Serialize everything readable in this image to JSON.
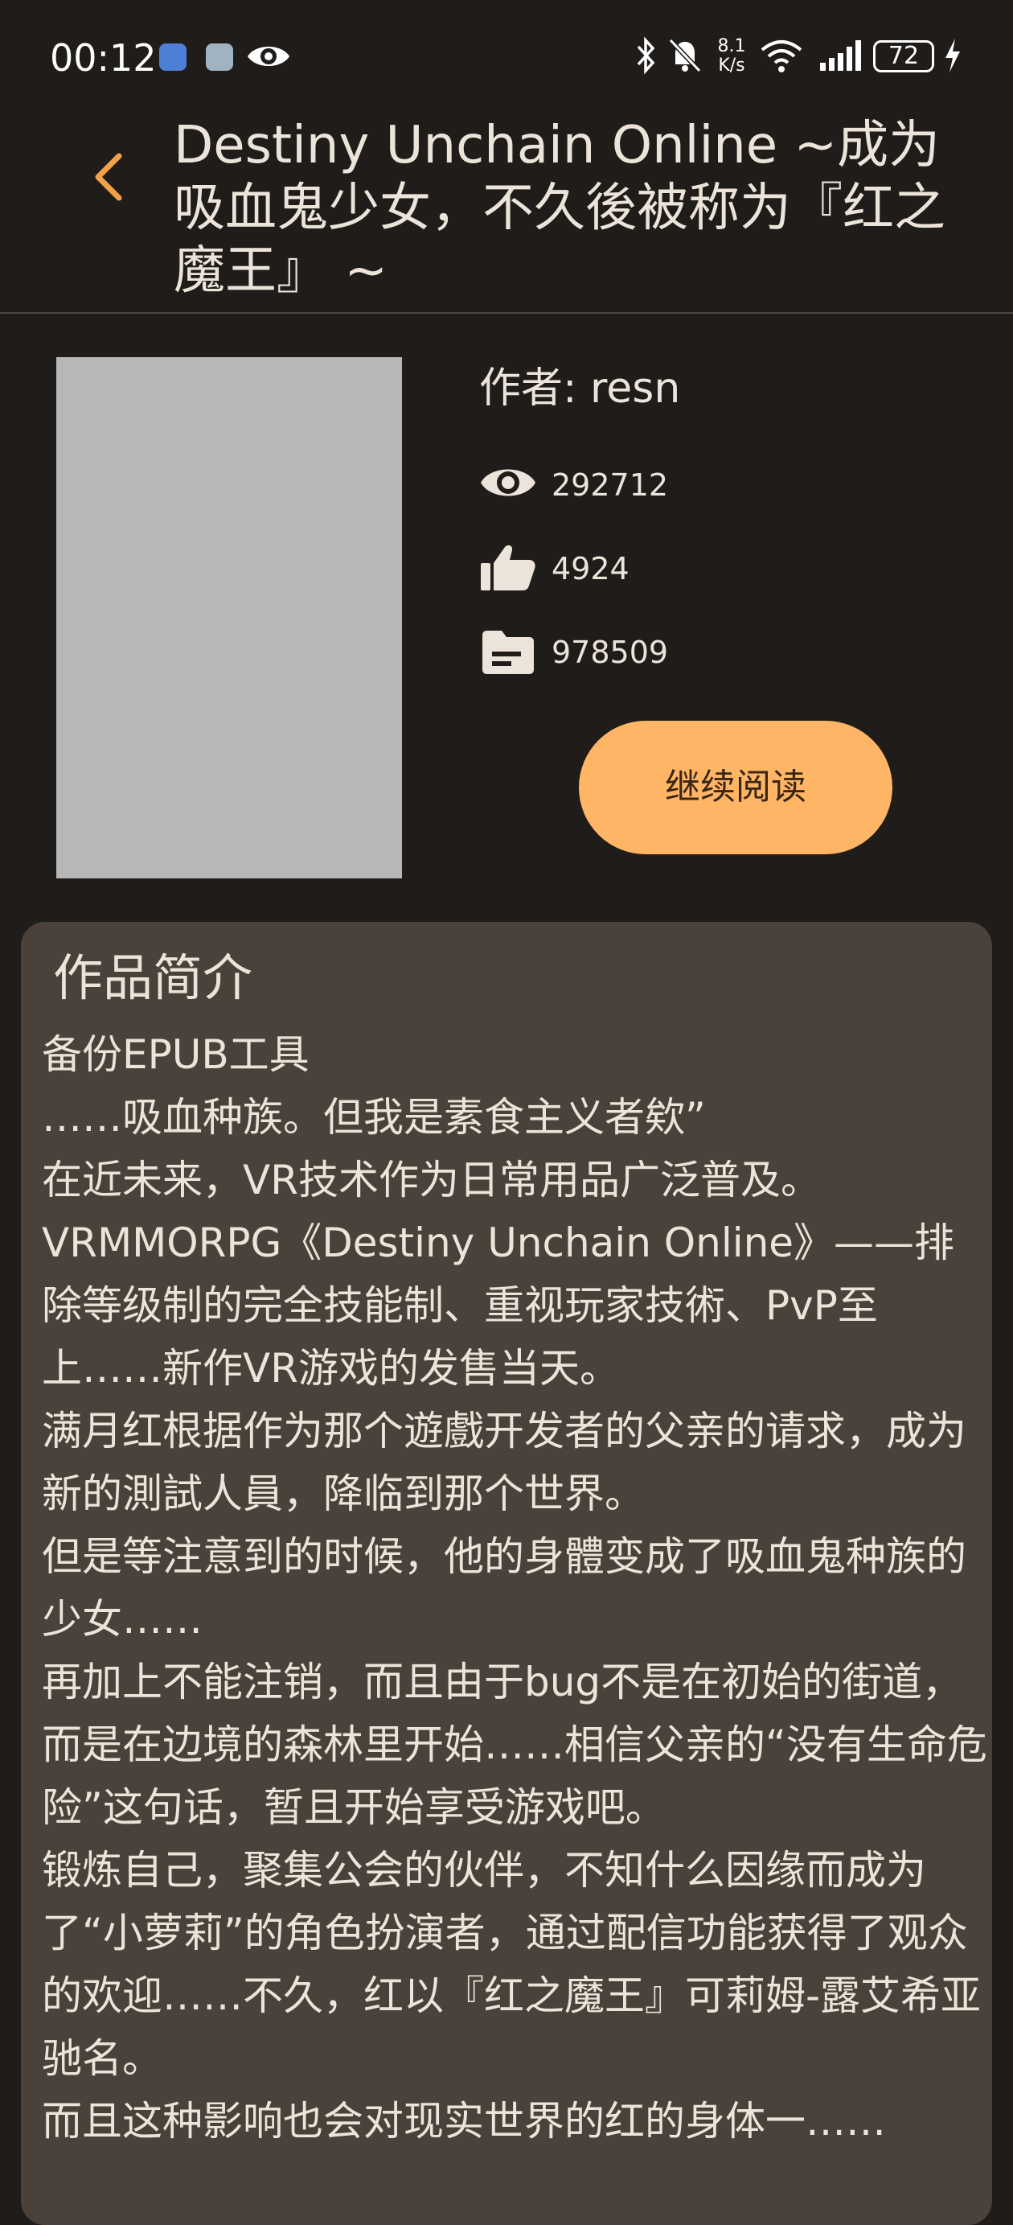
{
  "status_bar": {
    "time": "00:12",
    "network_speed_value": "8.1",
    "network_speed_unit": "K/s",
    "battery": "72",
    "icons": [
      "app-icon-1",
      "app-icon-2",
      "eye-icon",
      "bluetooth-icon",
      "mute-icon",
      "wifi-icon",
      "signal-icon",
      "battery-icon",
      "charging-icon"
    ]
  },
  "header": {
    "title": "Destiny Unchain Online ~成为吸血鬼少女，不久後被称为『红之魔王』 ~",
    "back_icon": "chevron-left-icon"
  },
  "book": {
    "author_label": "作者: resn",
    "views": "292712",
    "likes": "4924",
    "words": "978509",
    "continue_label": "继续阅读"
  },
  "synopsis": {
    "title": "作品简介",
    "paragraphs": [
      "备份EPUB工具",
      "……吸血种族。但我是素食主义者欸”",
      "在近未来，VR技术作为日常用品广泛普及。",
      "VRMMORPG《Destiny Unchain Online》——排除等级制的完全技能制、重视玩家技術、PvP至上……新作VR游戏的发售当天。",
      "满月红根据作为那个遊戲开发者的父亲的请求，成为新的測試人員，降临到那个世界。",
      "但是等注意到的时候，他的身體变成了吸血鬼种族的少女……",
      "再加上不能注销，而且由于bug不是在初始的街道，而是在边境的森林里开始……相信父亲的“没有生命危险”这句话，暂且开始享受游戏吧。",
      "锻炼自己，聚集公会的伙伴，不知什么因缘而成为了“小萝莉”的角色扮演者，通过配信功能获得了观众的欢迎……不久，红以『红之魔王』可莉姆-露艾希亚驰名。",
      "而且这种影响也会对现实世界的红的身体一……"
    ]
  },
  "colors": {
    "background": "#1f1c19",
    "card": "#4a423a",
    "accent": "#ffb566",
    "cover_placeholder": "#b7b7b7",
    "text": "#ece4da"
  }
}
